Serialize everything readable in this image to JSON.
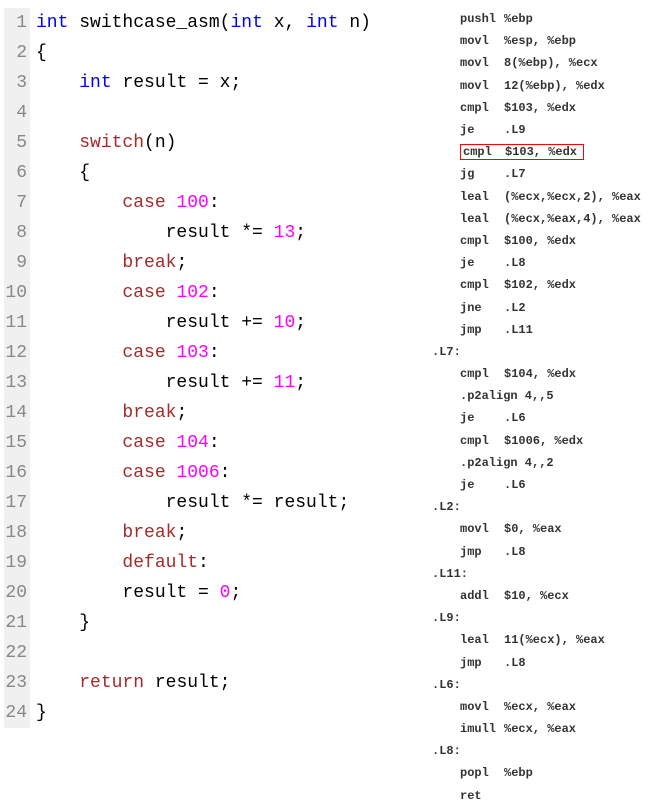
{
  "code": {
    "lines": [
      {
        "num": "1",
        "segments": [
          {
            "t": "int ",
            "c": "kw"
          },
          {
            "t": "swithcase_asm",
            "c": "fn-name"
          },
          {
            "t": "(",
            "c": "brace"
          },
          {
            "t": "int ",
            "c": "kw"
          },
          {
            "t": "x, ",
            "c": "ident"
          },
          {
            "t": "int ",
            "c": "kw"
          },
          {
            "t": "n)",
            "c": "ident"
          }
        ]
      },
      {
        "num": "2",
        "segments": [
          {
            "t": "{",
            "c": "brace"
          }
        ]
      },
      {
        "num": "3",
        "segments": [
          {
            "t": "    ",
            "c": ""
          },
          {
            "t": "int ",
            "c": "kw"
          },
          {
            "t": "result = x;",
            "c": "ident"
          }
        ]
      },
      {
        "num": "4",
        "segments": []
      },
      {
        "num": "5",
        "segments": [
          {
            "t": "    ",
            "c": ""
          },
          {
            "t": "switch",
            "c": "stmt"
          },
          {
            "t": "(n)",
            "c": "ident"
          }
        ]
      },
      {
        "num": "6",
        "segments": [
          {
            "t": "    {",
            "c": "brace"
          }
        ]
      },
      {
        "num": "7",
        "segments": [
          {
            "t": "        ",
            "c": ""
          },
          {
            "t": "case ",
            "c": "case-kw"
          },
          {
            "t": "100",
            "c": "num"
          },
          {
            "t": ":",
            "c": "ident"
          }
        ]
      },
      {
        "num": "8",
        "segments": [
          {
            "t": "            result *= ",
            "c": "ident"
          },
          {
            "t": "13",
            "c": "num"
          },
          {
            "t": ";",
            "c": "ident"
          }
        ]
      },
      {
        "num": "9",
        "segments": [
          {
            "t": "        ",
            "c": ""
          },
          {
            "t": "break",
            "c": "stmt"
          },
          {
            "t": ";",
            "c": "ident"
          }
        ]
      },
      {
        "num": "10",
        "segments": [
          {
            "t": "        ",
            "c": ""
          },
          {
            "t": "case ",
            "c": "case-kw"
          },
          {
            "t": "102",
            "c": "num"
          },
          {
            "t": ":",
            "c": "ident"
          }
        ]
      },
      {
        "num": "11",
        "segments": [
          {
            "t": "            result += ",
            "c": "ident"
          },
          {
            "t": "10",
            "c": "num"
          },
          {
            "t": ";",
            "c": "ident"
          }
        ]
      },
      {
        "num": "12",
        "segments": [
          {
            "t": "        ",
            "c": ""
          },
          {
            "t": "case ",
            "c": "case-kw"
          },
          {
            "t": "103",
            "c": "num"
          },
          {
            "t": ":",
            "c": "ident"
          }
        ]
      },
      {
        "num": "13",
        "segments": [
          {
            "t": "            result += ",
            "c": "ident"
          },
          {
            "t": "11",
            "c": "num"
          },
          {
            "t": ";",
            "c": "ident"
          }
        ]
      },
      {
        "num": "14",
        "segments": [
          {
            "t": "        ",
            "c": ""
          },
          {
            "t": "break",
            "c": "stmt"
          },
          {
            "t": ";",
            "c": "ident"
          }
        ]
      },
      {
        "num": "15",
        "segments": [
          {
            "t": "        ",
            "c": ""
          },
          {
            "t": "case ",
            "c": "case-kw"
          },
          {
            "t": "104",
            "c": "num"
          },
          {
            "t": ":",
            "c": "ident"
          }
        ]
      },
      {
        "num": "16",
        "segments": [
          {
            "t": "        ",
            "c": ""
          },
          {
            "t": "case ",
            "c": "case-kw"
          },
          {
            "t": "1006",
            "c": "num"
          },
          {
            "t": ":",
            "c": "ident"
          }
        ]
      },
      {
        "num": "17",
        "segments": [
          {
            "t": "            result *= result;",
            "c": "ident"
          }
        ]
      },
      {
        "num": "18",
        "segments": [
          {
            "t": "        ",
            "c": ""
          },
          {
            "t": "break",
            "c": "stmt"
          },
          {
            "t": ";",
            "c": "ident"
          }
        ]
      },
      {
        "num": "19",
        "segments": [
          {
            "t": "        ",
            "c": ""
          },
          {
            "t": "default",
            "c": "stmt"
          },
          {
            "t": ":",
            "c": "ident"
          }
        ]
      },
      {
        "num": "20",
        "segments": [
          {
            "t": "        result = ",
            "c": "ident"
          },
          {
            "t": "0",
            "c": "num"
          },
          {
            "t": ";",
            "c": "ident"
          }
        ]
      },
      {
        "num": "21",
        "segments": [
          {
            "t": "    }",
            "c": "brace"
          }
        ]
      },
      {
        "num": "22",
        "segments": []
      },
      {
        "num": "23",
        "segments": [
          {
            "t": "    ",
            "c": ""
          },
          {
            "t": "return ",
            "c": "stmt"
          },
          {
            "t": "result;",
            "c": "ident"
          }
        ]
      },
      {
        "num": "24",
        "segments": [
          {
            "t": "}",
            "c": "brace"
          }
        ]
      }
    ]
  },
  "asm": {
    "lines": [
      {
        "type": "instr",
        "op": "pushl",
        "args": "%ebp"
      },
      {
        "type": "instr",
        "op": "movl",
        "args": "%esp, %ebp"
      },
      {
        "type": "instr",
        "op": "movl",
        "args": "8(%ebp), %ecx"
      },
      {
        "type": "instr",
        "op": "movl",
        "args": "12(%ebp), %edx"
      },
      {
        "type": "instr",
        "op": "cmpl",
        "args": "$103, %edx"
      },
      {
        "type": "instr",
        "op": "je",
        "args": ".L9"
      },
      {
        "type": "highlight",
        "op": "cmpl",
        "args": "$103, %edx"
      },
      {
        "type": "instr",
        "op": "jg",
        "args": ".L7"
      },
      {
        "type": "instr",
        "op": "leal",
        "args": "(%ecx,%ecx,2), %eax"
      },
      {
        "type": "instr",
        "op": "leal",
        "args": "(%ecx,%eax,4), %eax"
      },
      {
        "type": "instr",
        "op": "cmpl",
        "args": "$100, %edx"
      },
      {
        "type": "instr",
        "op": "je",
        "args": ".L8"
      },
      {
        "type": "instr",
        "op": "cmpl",
        "args": "$102, %edx"
      },
      {
        "type": "instr",
        "op": "jne",
        "args": ".L2"
      },
      {
        "type": "instr",
        "op": "jmp",
        "args": ".L11"
      },
      {
        "type": "label",
        "text": ".L7:"
      },
      {
        "type": "instr",
        "op": "cmpl",
        "args": "$104, %edx"
      },
      {
        "type": "instr",
        "op": ".p2align",
        "args": "4,,5",
        "nogap": true
      },
      {
        "type": "instr",
        "op": "je",
        "args": ".L6"
      },
      {
        "type": "instr",
        "op": "cmpl",
        "args": "$1006, %edx"
      },
      {
        "type": "instr",
        "op": ".p2align",
        "args": "4,,2",
        "nogap": true
      },
      {
        "type": "instr",
        "op": "je",
        "args": ".L6"
      },
      {
        "type": "label",
        "text": ".L2:"
      },
      {
        "type": "instr",
        "op": "movl",
        "args": "$0, %eax"
      },
      {
        "type": "instr",
        "op": "jmp",
        "args": ".L8"
      },
      {
        "type": "label",
        "text": ".L11:"
      },
      {
        "type": "instr",
        "op": "addl",
        "args": "$10, %ecx"
      },
      {
        "type": "label",
        "text": ".L9:"
      },
      {
        "type": "instr",
        "op": "leal",
        "args": "11(%ecx), %eax"
      },
      {
        "type": "instr",
        "op": "jmp",
        "args": ".L8"
      },
      {
        "type": "label",
        "text": ".L6:"
      },
      {
        "type": "instr",
        "op": "movl",
        "args": "%ecx, %eax"
      },
      {
        "type": "instr",
        "op": "imull",
        "args": "%ecx, %eax"
      },
      {
        "type": "label",
        "text": ".L8:"
      },
      {
        "type": "instr",
        "op": "popl",
        "args": "%ebp"
      },
      {
        "type": "instr",
        "op": "ret",
        "args": ""
      }
    ]
  }
}
